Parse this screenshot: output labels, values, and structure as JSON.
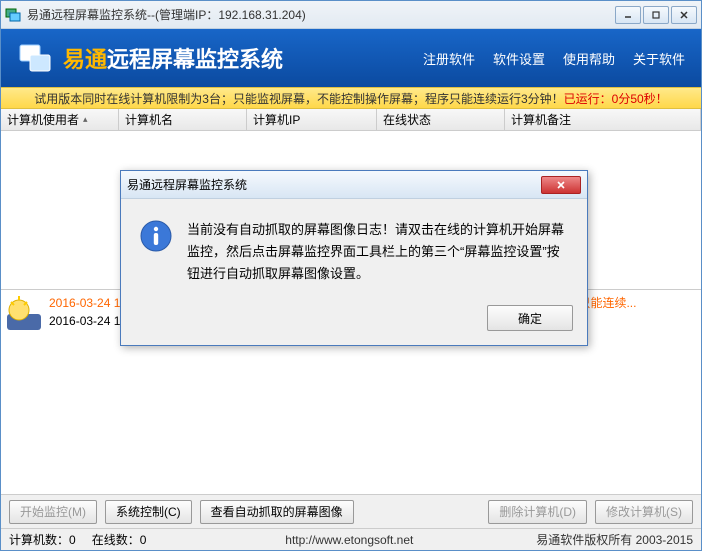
{
  "window": {
    "title": "易通远程屏幕监控系统--(管理端IP：192.168.31.204)"
  },
  "header": {
    "title_prefix": "易通",
    "title_suffix": "远程屏幕监控系统",
    "nav": {
      "register": "注册软件",
      "settings": "软件设置",
      "help": "使用帮助",
      "about": "关于软件"
    }
  },
  "trial": {
    "text_a": "试用版本同时在线计算机限制为3台；只能监视屏幕，不能控制操作屏幕；程序只能连续运行3分钟！",
    "text_b": "已运行：0分50秒！"
  },
  "table": {
    "headers": [
      "计算机使用者",
      "计算机名",
      "计算机IP",
      "在线状态",
      "计算机备注"
    ]
  },
  "log": {
    "line1": "2016-03-24 14:41:40 试用版本同时在线计算机限制为3台；只能监视屏幕，不能控制操作屏幕；程序只能连续...",
    "line2": "2016-03-24 14:41:40 易通远程屏幕监控系统进入正常工作状态，等被控端的连接..."
  },
  "buttons": {
    "start": "开始监控(M)",
    "sysctrl": "系统控制(C)",
    "viewcap": "查看自动抓取的屏幕图像",
    "delete": "删除计算机(D)",
    "modify": "修改计算机(S)"
  },
  "status": {
    "count": "计算机数：0",
    "online": "在线数：0",
    "url": "http://www.etongsoft.net",
    "copyright": "易通软件版权所有 2003-2015"
  },
  "dialog": {
    "title": "易通远程屏幕监控系统",
    "message": "当前没有自动抓取的屏幕图像日志！请双击在线的计算机开始屏幕监控，然后点击屏幕监控界面工具栏上的第三个“屏幕监控设置”按钮进行自动抓取屏幕图像设置。",
    "ok": "确定"
  }
}
